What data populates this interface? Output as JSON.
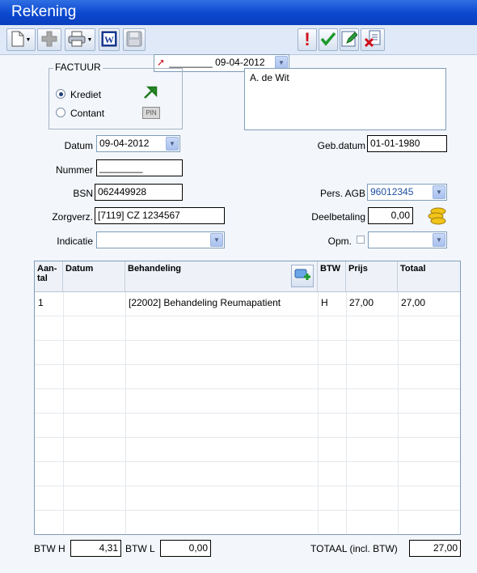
{
  "window": {
    "title": "Rekening"
  },
  "toolbar": {
    "date_selector_value": "________  09-04-2012",
    "buttons": [
      "new-document-icon",
      "add-icon",
      "print-icon",
      "word-icon",
      "save-icon",
      "exclamation-icon",
      "check-icon",
      "edit-icon",
      "delete-document-icon"
    ]
  },
  "factuur": {
    "legend": "FACTUUR",
    "options": [
      {
        "label": "Krediet",
        "selected": true
      },
      {
        "label": "Contant",
        "selected": false
      }
    ],
    "pin_label": "PIN"
  },
  "patient": {
    "name": "A. de Wit"
  },
  "form": {
    "datum_label": "Datum",
    "datum_value": "09-04-2012",
    "nummer_label": "Nummer",
    "nummer_value": "________",
    "bsn_label": "BSN",
    "bsn_value": "062449928",
    "zorgverz_label": "Zorgverz.",
    "zorgverz_value": "[7119] CZ  1234567",
    "indicatie_label": "Indicatie",
    "indicatie_value": "",
    "gebdatum_label": "Geb.datum",
    "gebdatum_value": "01-01-1980",
    "agb_label": "Pers. AGB",
    "agb_value": "96012345",
    "deelbetaling_label": "Deelbetaling",
    "deelbetaling_value": "0,00",
    "opm_label": "Opm.",
    "opm_value": ""
  },
  "table": {
    "headers": {
      "aantal": "Aan-\ntal",
      "datum": "Datum",
      "behandeling": "Behandeling",
      "btw": "BTW",
      "prijs": "Prijs",
      "totaal": "Totaal"
    },
    "rows": [
      {
        "aantal": "1",
        "datum": "",
        "behandeling": "[22002] Behandeling Reumapatient",
        "btw": "H",
        "prijs": "27,00",
        "totaal": "27,00"
      }
    ]
  },
  "footer": {
    "btw_h_label": "BTW H",
    "btw_h_value": "4,31",
    "btw_l_label": "BTW L",
    "btw_l_value": "0,00",
    "totaal_label": "TOTAAL (incl. BTW)",
    "totaal_value": "27,00"
  },
  "colors": {
    "title_bar": "#0b47cf",
    "accent_red": "#d0101a",
    "accent_green": "#1e9a2a"
  }
}
